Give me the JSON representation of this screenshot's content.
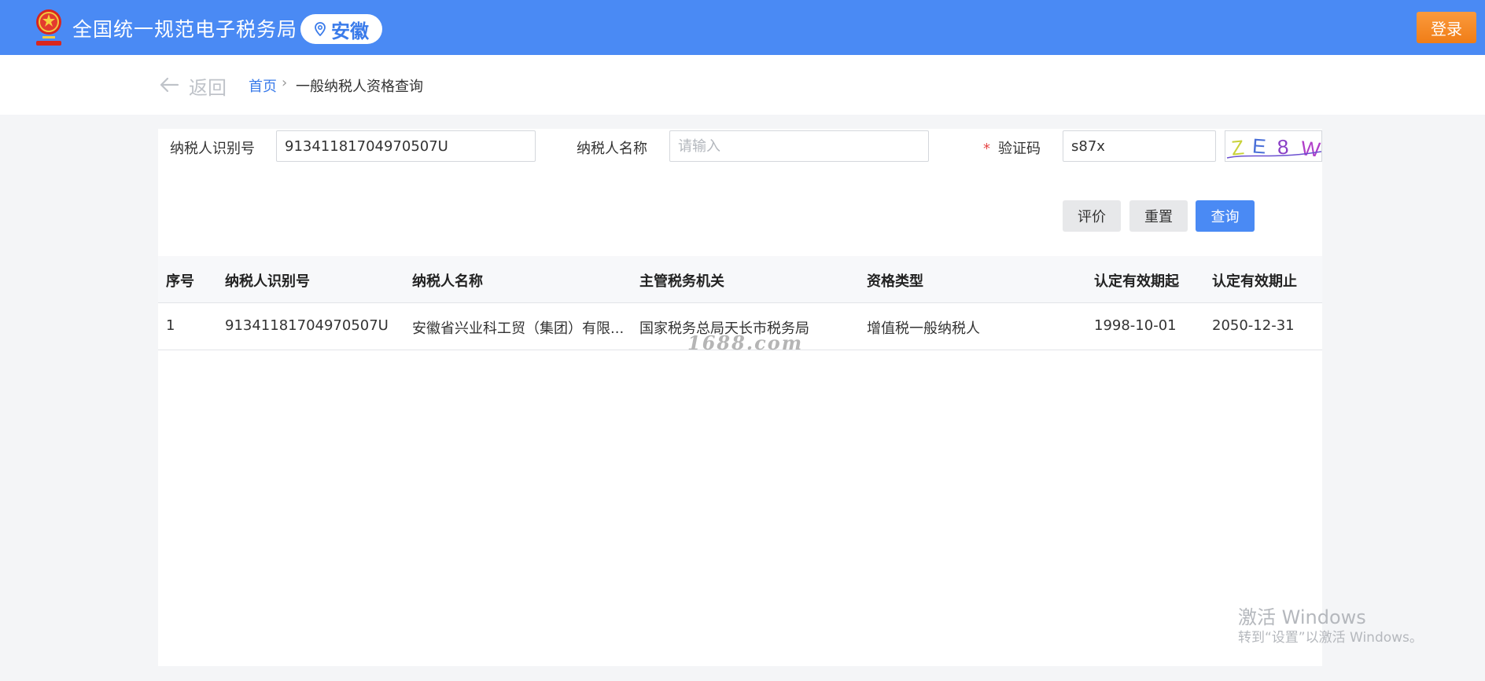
{
  "header": {
    "site_title": "全国统一规范电子税务局",
    "region": "安徽",
    "login_label": "登录",
    "colors": {
      "bar": "#4a8af4",
      "login": "#f08a24",
      "accent": "#3a7bea"
    },
    "icons": {
      "emblem": "national-emblem-icon",
      "region": "location-pin-icon"
    }
  },
  "breadcrumb": {
    "back_label": "返回",
    "home": "首页",
    "separator": "›",
    "current": "一般纳税人资格查询"
  },
  "form": {
    "taxpayer_id": {
      "label": "纳税人识别号",
      "value": "91341181704970507U"
    },
    "taxpayer_name": {
      "label": "纳税人名称",
      "placeholder": "请输入",
      "value": ""
    },
    "captcha": {
      "required_mark": "*",
      "label": "验证码",
      "value": "s87x",
      "image_text": "ZE8W"
    },
    "buttons": {
      "evaluate": "评价",
      "reset": "重置",
      "query": "查询"
    }
  },
  "table": {
    "columns": [
      "序号",
      "纳税人识别号",
      "纳税人名称",
      "主管税务机关",
      "资格类型",
      "认定有效期起",
      "认定有效期止"
    ],
    "rows": [
      [
        "1",
        "91341181704970507U",
        "安徽省兴业科工贸（集团）有限...",
        "国家税务总局天长市税务局",
        "增值税一般纳税人",
        "1998-10-01",
        "2050-12-31"
      ]
    ]
  },
  "overlay": {
    "watermark": "1688.com",
    "activate_title": "激活 Windows",
    "activate_sub": "转到“设置”以激活 Windows。"
  }
}
